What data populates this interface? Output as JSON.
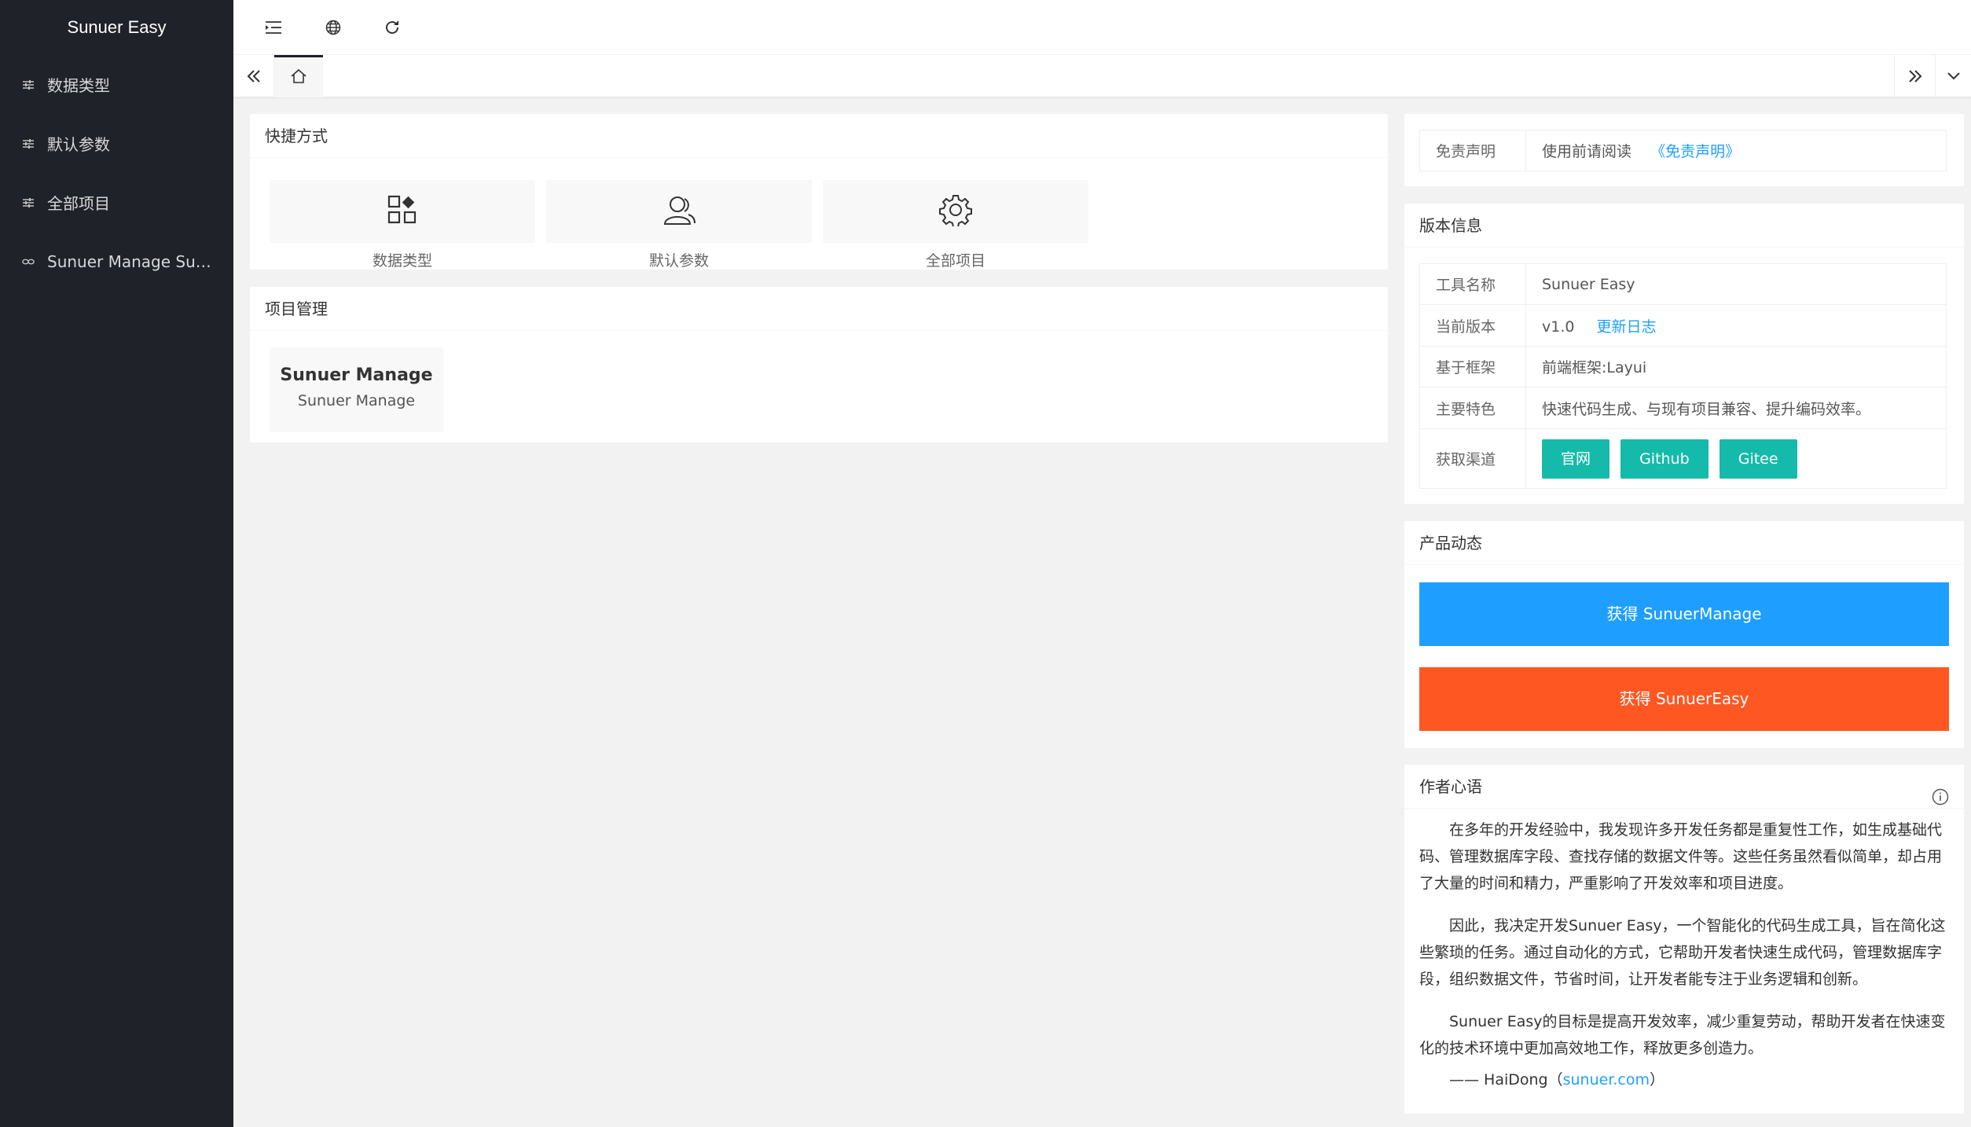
{
  "app": {
    "title": "Sunuer Easy"
  },
  "sidebar": {
    "items": [
      {
        "label": "数据类型",
        "icon": "sliders-icon"
      },
      {
        "label": "默认参数",
        "icon": "sliders-icon"
      },
      {
        "label": "全部项目",
        "icon": "sliders-icon"
      },
      {
        "label": "Sunuer Manage Sun...",
        "icon": "link-icon"
      }
    ]
  },
  "header": {
    "icons": [
      "menu-fold-icon",
      "globe-icon",
      "refresh-icon"
    ]
  },
  "tabs": {
    "home_icon": "home-icon"
  },
  "shortcuts": {
    "title": "快捷方式",
    "items": [
      {
        "label": "数据类型",
        "icon": "apps-icon"
      },
      {
        "label": "默认参数",
        "icon": "user-icon"
      },
      {
        "label": "全部项目",
        "icon": "gear-icon"
      }
    ]
  },
  "projects": {
    "title": "项目管理",
    "items": [
      {
        "title": "Sunuer Manage",
        "subtitle": "Sunuer Manage"
      }
    ]
  },
  "disclaimer": {
    "key": "免责声明",
    "text": "使用前请阅读",
    "link": "《免责声明》"
  },
  "version_info": {
    "title": "版本信息",
    "rows": [
      {
        "key": "工具名称",
        "value": "Sunuer Easy"
      },
      {
        "key": "当前版本",
        "value": "v1.0",
        "link": "更新日志"
      },
      {
        "key": "基于框架",
        "value": "前端框架:Layui"
      },
      {
        "key": "主要特色",
        "value": "快速代码生成、与现有项目兼容、提升编码效率。"
      },
      {
        "key": "获取渠道",
        "buttons": [
          "官网",
          "Github",
          "Gitee"
        ]
      }
    ]
  },
  "product_news": {
    "title": "产品动态",
    "button_manage": "获得 SunuerManage",
    "button_easy": "获得 SunuerEasy",
    "colors": {
      "manage": "#1e9fff",
      "easy": "#ff5722"
    }
  },
  "author": {
    "title": "作者心语",
    "paragraphs": [
      "在多年的开发经验中，我发现许多开发任务都是重复性工作，如生成基础代码、管理数据库字段、查找存储的数据文件等。这些任务虽然看似简单，却占用了大量的时间和精力，严重影响了开发效率和项目进度。",
      "因此，我决定开发Sunuer Easy，一个智能化的代码生成工具，旨在简化这些繁琐的任务。通过自动化的方式，它帮助开发者快速生成代码，管理数据库字段，组织数据文件，节省时间，让开发者能专注于业务逻辑和创新。",
      "Sunuer Easy的目标是提高开发效率，减少重复劳动，帮助开发者在快速变化的技术环境中更加高效地工作，释放更多创造力。"
    ],
    "signature": "—— HaiDong（",
    "signature_link": "sunuer.com",
    "signature_end": "）"
  },
  "colors": {
    "sidebar": "#20222a",
    "accent_green": "#16baaa",
    "link": "#1e9fff"
  }
}
